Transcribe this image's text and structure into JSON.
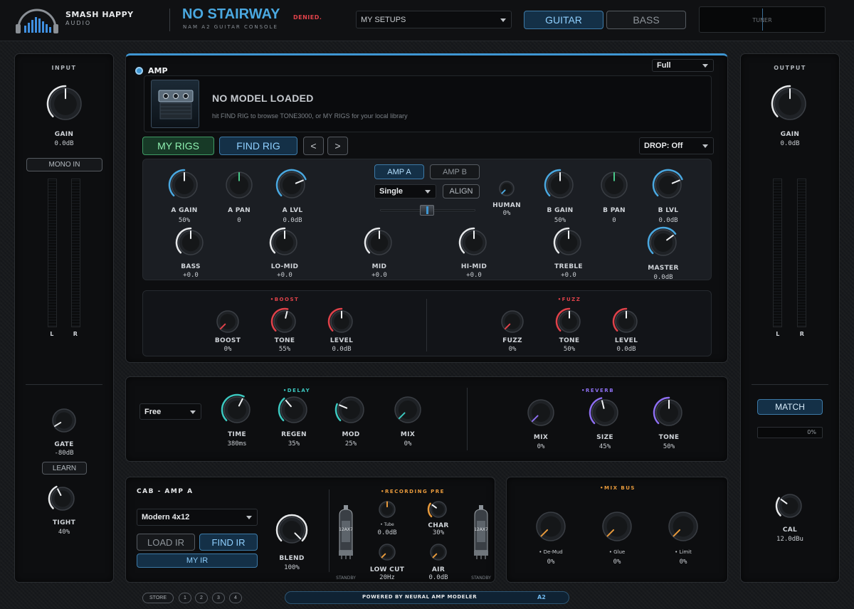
{
  "header": {
    "brand_line1": "SMASH HAPPY",
    "brand_line2": "AUDIO",
    "product_title": "NO STAIRWAY",
    "denied_badge": "DENIED.",
    "subtitle": "NAM A2 GUITAR CONSOLE",
    "setups_dropdown": "MY SETUPS",
    "guitar_tab": "GUITAR",
    "bass_tab": "BASS",
    "tuner_label": "TUNER"
  },
  "input": {
    "title": "INPUT",
    "gain_label": "GAIN",
    "gain_value": "0.0dB",
    "mono_button": "MONO IN",
    "meter_left": "L",
    "meter_right": "R",
    "gate_label": "GATE",
    "gate_value": "-80dB",
    "learn_button": "LEARN",
    "tight_label": "TIGHT",
    "tight_value": "40%"
  },
  "output": {
    "title": "OUTPUT",
    "gain_label": "GAIN",
    "gain_value": "0.0dB",
    "meter_left": "L",
    "meter_right": "R",
    "match_button": "MATCH",
    "match_progress": "0%",
    "cal_label": "CAL",
    "cal_value": "12.0dBu"
  },
  "amp": {
    "title": "AMP",
    "mode_dropdown": "Full",
    "model_title": "NO MODEL LOADED",
    "model_hint": "hit FIND RIG to browse TONE3000, or MY RIGS for your local library",
    "my_rigs": "MY RIGS",
    "find_rig": "FIND RIG",
    "prev": "<",
    "next": ">",
    "drop_dropdown": "DROP: Off",
    "amp_a": "AMP A",
    "amp_b": "AMP B",
    "single_dropdown": "Single",
    "align_button": "ALIGN",
    "knobs_top": [
      {
        "label": "A GAIN",
        "value": "50%"
      },
      {
        "label": "A PAN",
        "value": "0"
      },
      {
        "label": "A LVL",
        "value": "0.0dB"
      },
      {
        "label": "HUMAN",
        "value": "0%"
      },
      {
        "label": "B GAIN",
        "value": "50%"
      },
      {
        "label": "B PAN",
        "value": "0"
      },
      {
        "label": "B LVL",
        "value": "0.0dB"
      }
    ],
    "knobs_eq": [
      {
        "label": "BASS",
        "value": "+0.0"
      },
      {
        "label": "LO-MID",
        "value": "+0.0"
      },
      {
        "label": "MID",
        "value": "+0.0"
      },
      {
        "label": "HI-MID",
        "value": "+0.0"
      },
      {
        "label": "TREBLE",
        "value": "+0.0"
      },
      {
        "label": "MASTER",
        "value": "0.0dB"
      }
    ]
  },
  "boost": {
    "section": "•BOOST",
    "knobs": [
      {
        "label": "BOOST",
        "value": "0%"
      },
      {
        "label": "TONE",
        "value": "55%"
      },
      {
        "label": "LEVEL",
        "value": "0.0dB"
      }
    ]
  },
  "fuzz": {
    "section": "•FUZZ",
    "knobs": [
      {
        "label": "FUZZ",
        "value": "0%"
      },
      {
        "label": "TONE",
        "value": "50%"
      },
      {
        "label": "LEVEL",
        "value": "0.0dB"
      }
    ]
  },
  "delay": {
    "section": "•DELAY",
    "sync_dropdown": "Free",
    "knobs": [
      {
        "label": "TIME",
        "value": "380ms"
      },
      {
        "label": "REGEN",
        "value": "35%"
      },
      {
        "label": "MOD",
        "value": "25%"
      },
      {
        "label": "MIX",
        "value": "0%"
      }
    ]
  },
  "reverb": {
    "section": "•REVERB",
    "knobs": [
      {
        "label": "MIX",
        "value": "0%"
      },
      {
        "label": "SIZE",
        "value": "45%"
      },
      {
        "label": "TONE",
        "value": "50%"
      }
    ]
  },
  "cab": {
    "title": "CAB - AMP A",
    "cab_dropdown": "Modern 4x12",
    "load_ir": "LOAD IR",
    "find_ir": "FIND IR",
    "my_ir": "MY IR",
    "blend_label": "BLEND",
    "blend_value": "100%"
  },
  "recording_pre": {
    "section": "•RECORDING PRE",
    "tube_tag": "• Tube",
    "tube_value": "0.0dB",
    "char_label": "CHAR",
    "char_value": "30%",
    "lowcut_label": "LOW CUT",
    "lowcut_value": "20Hz",
    "air_label": "AIR",
    "air_value": "0.0dB",
    "tube_left_text": "12AX7",
    "tube_right_text": "12AX7",
    "standby_left": "STANDBY",
    "standby_right": "STANDBY"
  },
  "mix_bus": {
    "section": "•MIX BUS",
    "knobs": [
      {
        "tag": "• De-Mud",
        "value": "0%"
      },
      {
        "tag": "• Glue",
        "value": "0%"
      },
      {
        "tag": "• Limit",
        "value": "0%"
      }
    ]
  },
  "footer": {
    "store": "STORE",
    "slots": [
      "1",
      "2",
      "3",
      "4"
    ],
    "powered_by": "POWERED BY NEURAL AMP MODELER",
    "version": "A2"
  },
  "colors": {
    "accent_blue": "#4aa8e0",
    "accent_green": "#49c98a",
    "accent_red": "#e0424a",
    "accent_purple": "#8d6ff0",
    "accent_orange": "#e89a3c",
    "accent_teal": "#3cc8c0"
  }
}
